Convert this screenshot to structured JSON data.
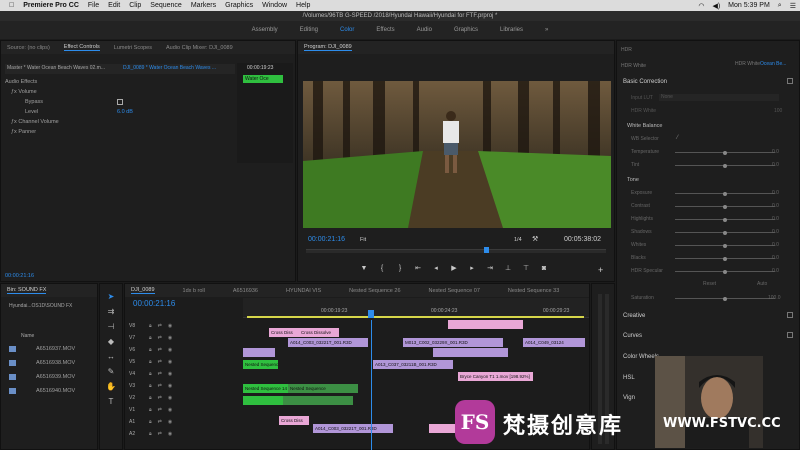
{
  "menubar": {
    "app": "Premiere Pro CC",
    "items": [
      "File",
      "Edit",
      "Clip",
      "Sequence",
      "Markers",
      "Graphics",
      "Window",
      "Help"
    ],
    "clock": "Mon 5:39 PM"
  },
  "title": "/Volumes/96TB G-SPEED /2018/Hyundai Hawaii/Hyundai for FTF.prproj *",
  "workspaces": {
    "items": [
      "Assembly",
      "Editing",
      "Color",
      "Effects",
      "Audio",
      "Graphics",
      "Libraries"
    ],
    "active": "Color",
    "more": "»"
  },
  "effect_controls": {
    "tabs": [
      "Source: (no clips)",
      "Effect Controls",
      "Lumetri Scopes",
      "Audio Clip Mixer: DJI_0089"
    ],
    "master": "Master * Water Ocean Beach Waves 02.m...",
    "clip_path": "DJI_0089 * Water Ocean Beach Waves ...",
    "timecode": "00:00:19:23",
    "clip_label": "Water Oce",
    "section": "Audio Effects",
    "volume": "Volume",
    "bypass": "Bypass",
    "level": "Level",
    "level_value": "6.0 dB",
    "channel_volume": "Channel Volume",
    "panner": "Panner",
    "bottom_timecode": "00:00:21:16"
  },
  "program": {
    "title": "Program: DJI_0089",
    "timecode": "00:00:21:16",
    "fit": "Fit",
    "fraction": "1/4",
    "duration": "00:05:38:02"
  },
  "lumetri": {
    "header1": "HDR",
    "header2": "HDR White",
    "header_right": "HDR White",
    "header_right_sub": "Ocean Be...",
    "basic_correction": "Basic Correction",
    "input_lut": "Input LUT",
    "input_lut_value": "None",
    "hdr_white": "HDR White",
    "hdr_white_value": "100",
    "white_balance": "White Balance",
    "wb_selector": "WB Selector",
    "temperature": "Temperature",
    "tint": "Tint",
    "tone": "Tone",
    "tone_rows": [
      "Exposure",
      "Contrast",
      "Highlights",
      "Shadows",
      "Whites",
      "Blacks",
      "HDR Specular"
    ],
    "zero": "0.0",
    "reset": "Reset",
    "auto": "Auto",
    "saturation": "Saturation",
    "saturation_value": "100.0",
    "creative": "Creative",
    "curves": "Curves",
    "color_wheels": "Color Wheels",
    "hsl": "HSL",
    "vignette": "Vign"
  },
  "bin": {
    "title": "Bin: SOUND FX",
    "path": "Hyundai...OS1D\\SOUND FX",
    "name_col": "Name",
    "items": [
      "A6516937.MOV",
      "A6516938.MOV",
      "A6516939.MOV",
      "A6516940.MOV"
    ]
  },
  "timeline": {
    "tabs": [
      "DJI_0089",
      "1dx b roll",
      "A6516936",
      "HYUNDAI VIS",
      "Nested Sequence 26",
      "Nested Sequence 07",
      "Nested Sequence 33"
    ],
    "timecode": "00:00:21:16",
    "ruler": [
      "00:00:19:23",
      "00:00:24:23",
      "00:00:29:23"
    ],
    "tracks": [
      "V8",
      "V7",
      "V6",
      "V5",
      "V4",
      "V3",
      "V2",
      "V1",
      "A1",
      "A2"
    ],
    "clips": {
      "cross_dissolve": "Cross Diss",
      "cross_dissolve2": "Cross Dissolve",
      "a014_1": "A014_C003_03221T_001.R3D",
      "m013": "M013_C002_03229X_001.R3D",
      "a014_2": "A014_C049_03124",
      "nested11": "Nested Sequence 11",
      "a013": "A013_C037_03211B_001.R3D",
      "bryce": "Bryce Canyon T1 1.mov [198.92%]",
      "nested14": "Nested Sequence 14",
      "nested_seq": "Nested Sequence",
      "a014_3": "A014_C003_03221T_001.R3D",
      "cross_diss3": "Cross Diss"
    }
  },
  "watermark": {
    "brand": "梵摄创意库",
    "url": "WWW.FSTVC.CC",
    "logo_text": "FS"
  }
}
